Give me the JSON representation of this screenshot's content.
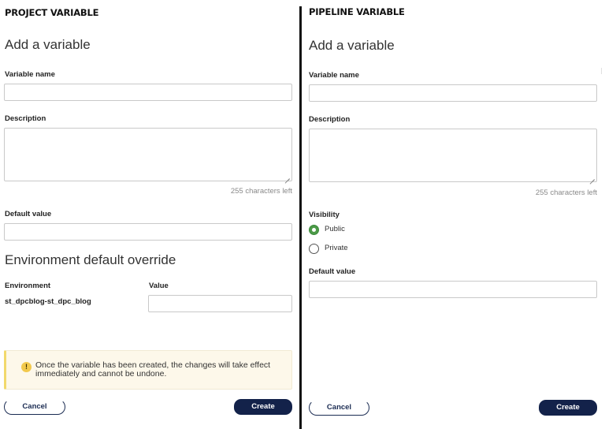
{
  "project": {
    "section_title": "PROJECT VARIABLE",
    "heading": "Add a variable",
    "variable_name_label": "Variable name",
    "variable_name_value": "",
    "description_label": "Description",
    "description_value": "",
    "description_counter": "255 characters left",
    "default_value_label": "Default value",
    "default_value_value": "",
    "env_override_heading": "Environment default override",
    "env_table": {
      "col_environment": "Environment",
      "col_value": "Value",
      "rows": [
        {
          "environment": "st_dpcblog-st_dpc_blog",
          "value": ""
        }
      ]
    },
    "notice": {
      "icon": "warning-icon",
      "glyph": "!",
      "text": "Once the variable has been created, the changes will take effect immediately and cannot be undone."
    },
    "cancel_label": "Cancel",
    "create_label": "Create"
  },
  "pipeline": {
    "section_title": "PIPELINE VARIABLE",
    "heading": "Add a variable",
    "variable_name_label": "Variable name",
    "variable_name_value": "",
    "description_label": "Description",
    "description_value": "",
    "description_counter": "255 characters left",
    "visibility_label": "Visibility",
    "visibility_options": [
      {
        "label": "Public",
        "selected": true
      },
      {
        "label": "Private",
        "selected": false
      }
    ],
    "default_value_label": "Default value",
    "default_value_value": "",
    "cancel_label": "Cancel",
    "create_label": "Create"
  },
  "colors": {
    "primary_button": "#13224a",
    "radio_selected": "#4c9a48",
    "notice_background": "#fdf8ea",
    "notice_accent": "#f2d96b"
  }
}
